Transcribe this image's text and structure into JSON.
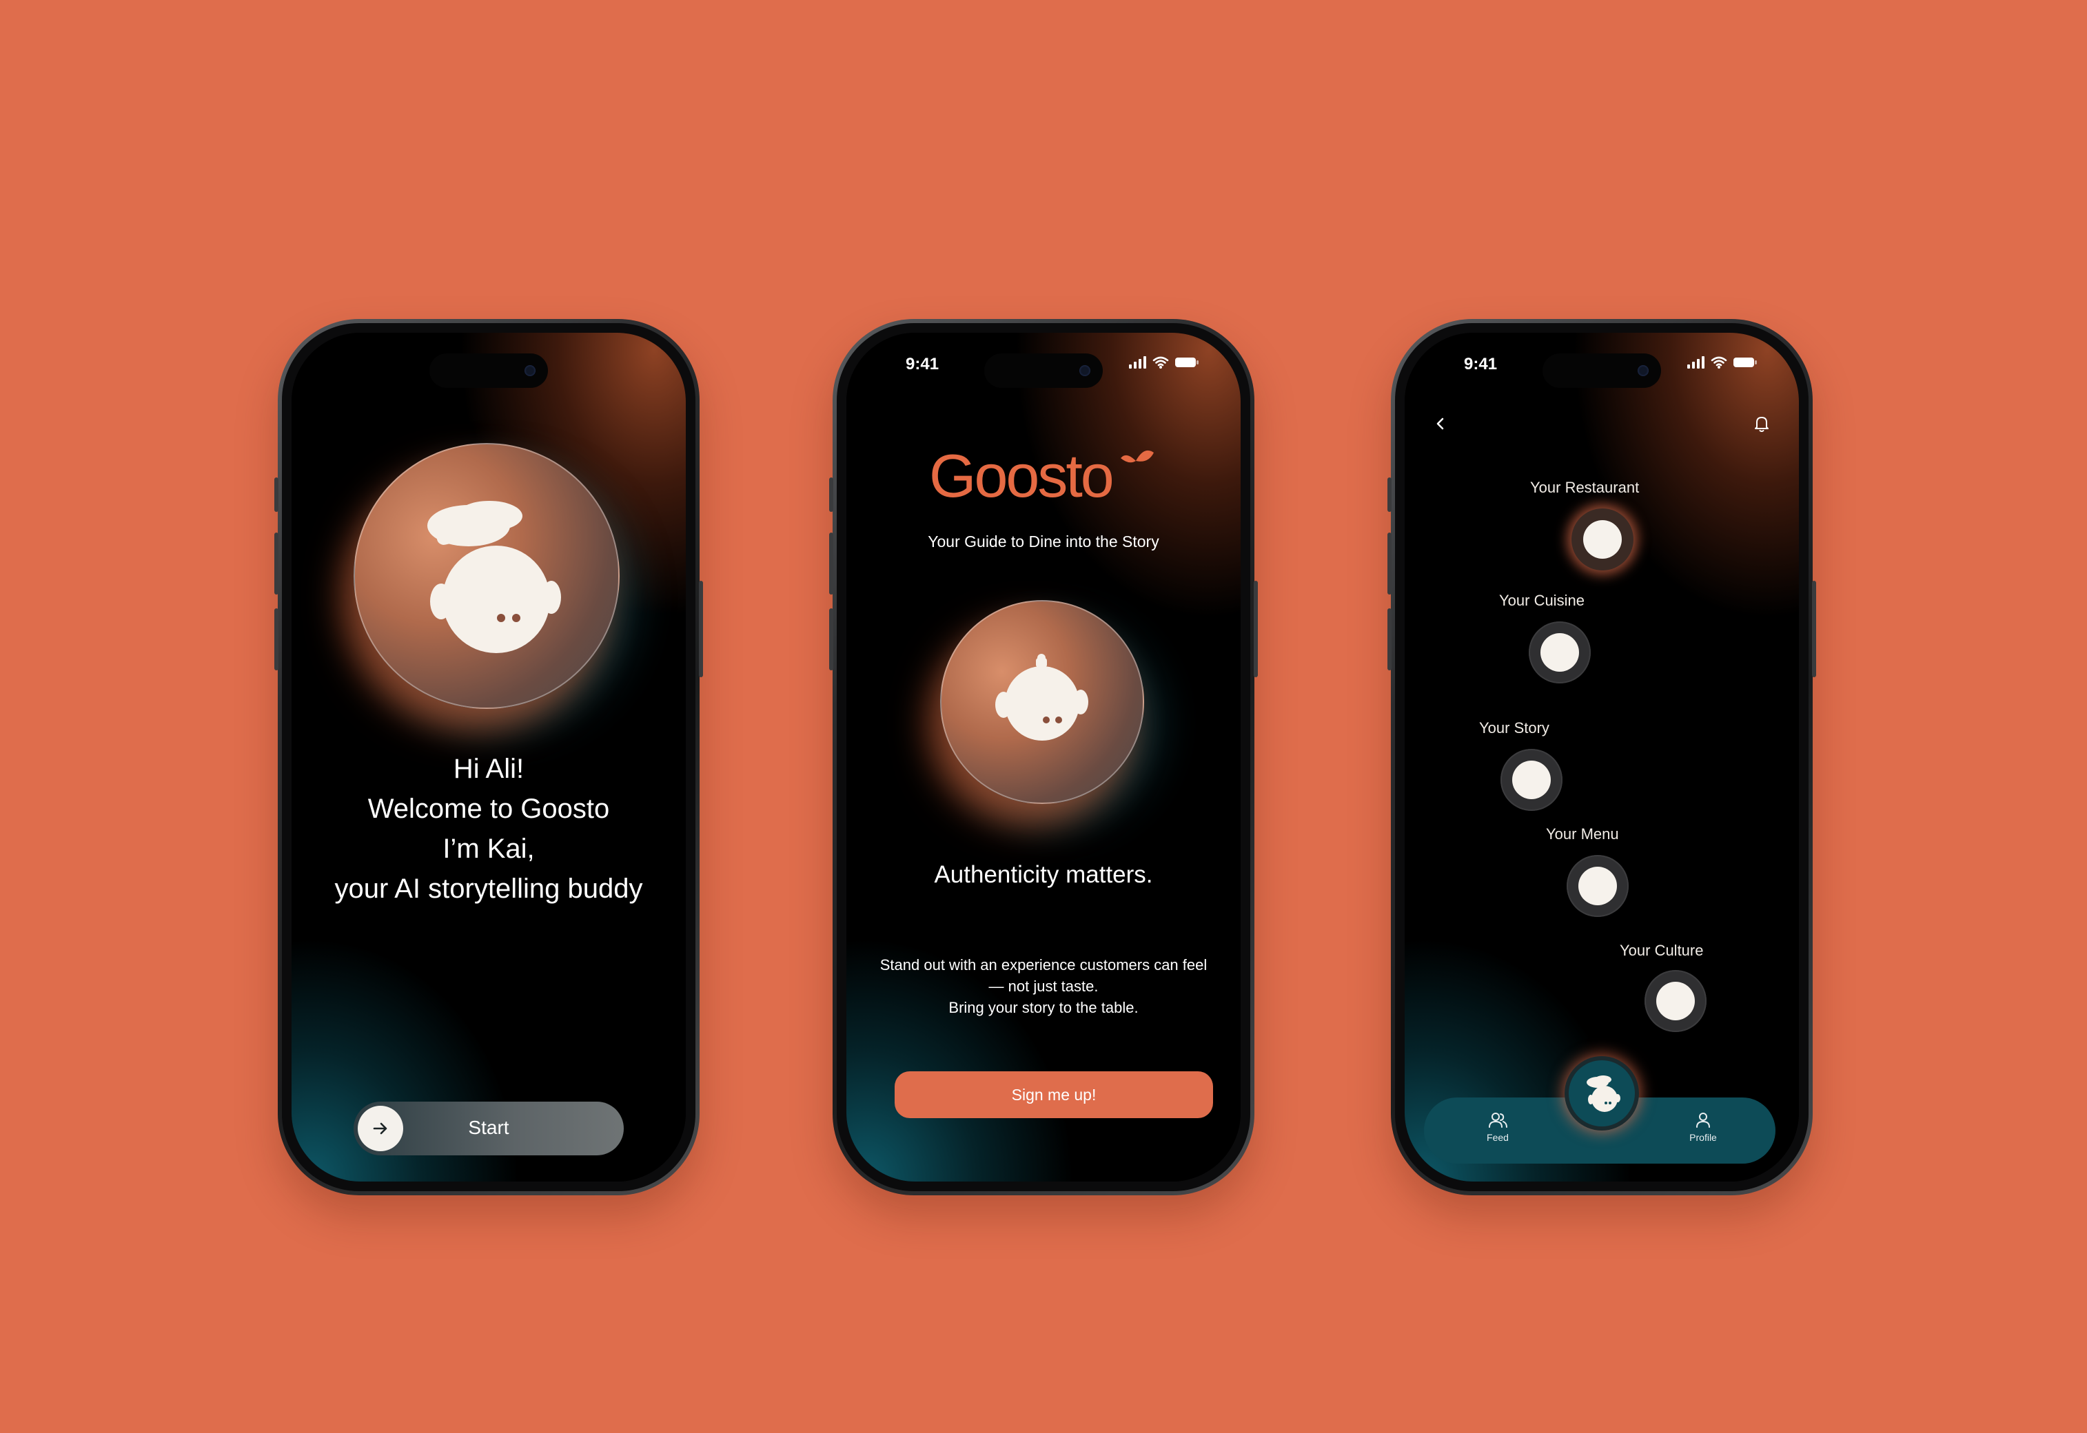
{
  "colors": {
    "background": "#DF6D4C",
    "accent": "#DF6D4C",
    "teal": "#0D4B57"
  },
  "phone1": {
    "avatar_icon": "chef-hat-robot-icon",
    "welcome_lines": [
      "Hi Ali!",
      "Welcome to Goosto",
      "I’m Kai,",
      "your AI storytelling buddy"
    ],
    "start_icon": "arrow-right-icon",
    "start_label": "Start"
  },
  "phone2": {
    "status_time": "9:41",
    "logo_text": "Goosto",
    "tagline": "Your Guide to Dine into the Story",
    "avatar_icon": "robot-avatar-icon",
    "headline": "Authenticity matters.",
    "body_lines": [
      "Stand out with an experience customers can feel",
      "— not just taste.",
      "Bring your story to the table."
    ],
    "signup_label": "Sign me up!"
  },
  "phone3": {
    "status_time": "9:41",
    "back_icon": "chevron-left-icon",
    "bell_icon": "bell-icon",
    "nodes": [
      {
        "label": "Your Restaurant",
        "active": true
      },
      {
        "label": "Your Cuisine",
        "active": false
      },
      {
        "label": "Your Story",
        "active": false
      },
      {
        "label": "Your Menu",
        "active": false
      },
      {
        "label": "Your Culture",
        "active": false
      }
    ],
    "tabs": {
      "feed": "Feed",
      "profile": "Profile"
    }
  }
}
